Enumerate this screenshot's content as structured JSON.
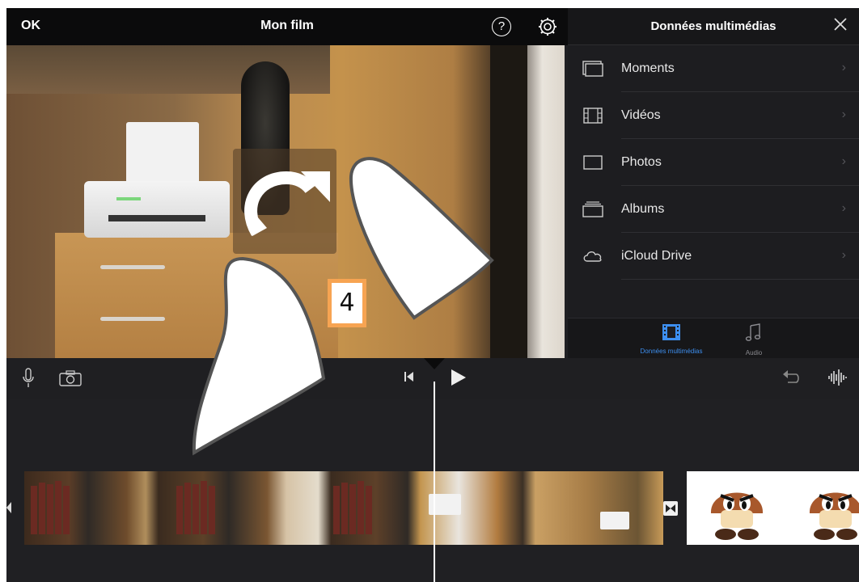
{
  "topbar": {
    "done_label": "OK",
    "project_title": "Mon film"
  },
  "media_panel": {
    "title": "Données multimédias",
    "items": [
      {
        "label": "Moments",
        "icon": "moments-icon"
      },
      {
        "label": "Vidéos",
        "icon": "film-icon"
      },
      {
        "label": "Photos",
        "icon": "photo-icon"
      },
      {
        "label": "Albums",
        "icon": "albums-icon"
      },
      {
        "label": "iCloud Drive",
        "icon": "cloud-icon"
      }
    ],
    "tabs": [
      {
        "label": "Données multimédias",
        "active": true,
        "color": "#3d8ff0"
      },
      {
        "label": "Audio",
        "active": false,
        "color": "#8a8a8f"
      }
    ]
  },
  "annotation": {
    "step_number": "4"
  },
  "colors": {
    "background": "#202023",
    "topbar": "#0b0b0c",
    "accent": "#3d8ff0",
    "badge": "#f7a452"
  }
}
